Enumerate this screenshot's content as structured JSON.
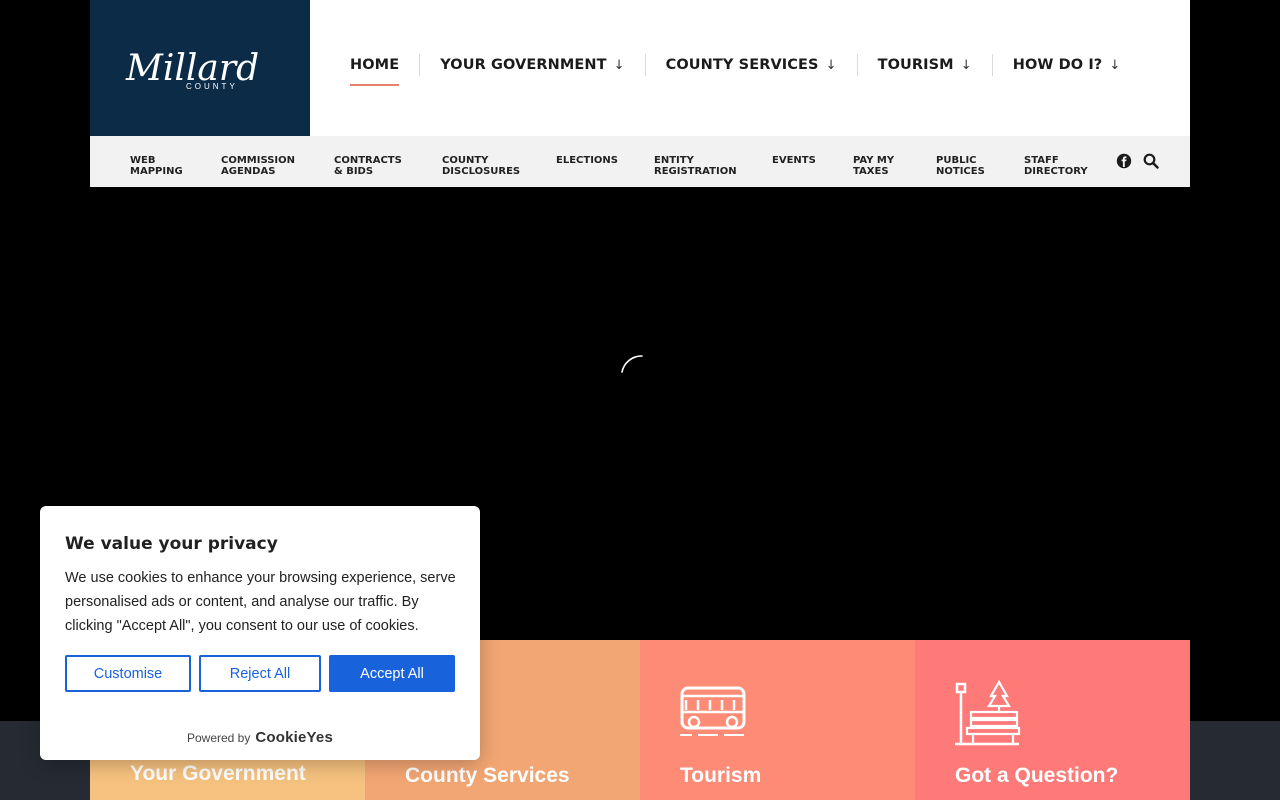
{
  "logo": {
    "script_text": "Millard",
    "subtext": "COUNTY"
  },
  "main_nav": [
    {
      "label": "HOME",
      "has_dropdown": false,
      "active": true
    },
    {
      "label": "YOUR GOVERNMENT",
      "has_dropdown": true,
      "active": false
    },
    {
      "label": "COUNTY SERVICES",
      "has_dropdown": true,
      "active": false
    },
    {
      "label": "TOURISM",
      "has_dropdown": true,
      "active": false
    },
    {
      "label": "HOW DO I?",
      "has_dropdown": true,
      "active": false
    }
  ],
  "dropdown_glyph": "↓",
  "sub_nav": [
    {
      "label": "WEB\nMAPPING"
    },
    {
      "label": "COMMISSION\nAGENDAS"
    },
    {
      "label": "CONTRACTS\n& BIDS"
    },
    {
      "label": "COUNTY\nDISCLOSURES"
    },
    {
      "label": "ELECTIONS"
    },
    {
      "label": "ENTITY\nREGISTRATION"
    },
    {
      "label": "EVENTS"
    },
    {
      "label": "PAY MY\nTAXES"
    },
    {
      "label": "PUBLIC\nNOTICES"
    },
    {
      "label": "STAFF\nDIRECTORY"
    }
  ],
  "sub_nav_icons": [
    "facebook-icon",
    "search-icon"
  ],
  "tiles": [
    {
      "title": "Your Government",
      "color": "#f6c27f",
      "icon": "none"
    },
    {
      "title": "County Services",
      "color": "#f2a673",
      "icon": "none"
    },
    {
      "title": "Tourism",
      "color": "#fd8b76",
      "icon": "bus-icon"
    },
    {
      "title": "Got a Question?",
      "color": "#fd7a78",
      "icon": "park-bench-icon"
    }
  ],
  "cookie_banner": {
    "title": "We value your privacy",
    "text": "We use cookies to enhance your browsing experience, serve personalised ads or content, and analyse our traffic. By clicking \"Accept All\", you consent to our use of cookies.",
    "customise_label": "Customise",
    "reject_label": "Reject All",
    "accept_label": "Accept All",
    "powered_by": "Powered by",
    "brand": "CookieYes"
  },
  "colors": {
    "header_brand": "#0c2b47",
    "active_underline": "#e9806e",
    "accent_button": "#1863dc",
    "footer_band": "#262b33"
  }
}
